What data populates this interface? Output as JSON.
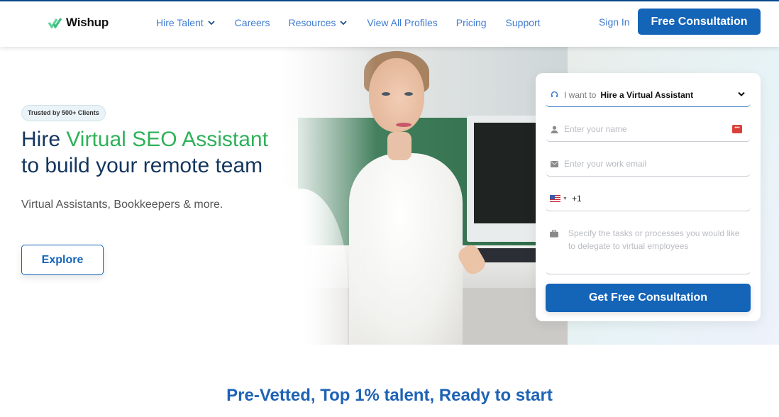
{
  "brand": {
    "name": "Wishup",
    "logo_icon": "double-check-icon",
    "accent_color": "#2fb15a",
    "primary_color": "#1464b8",
    "nav_link_color": "#3f7bd0",
    "heading_color": "#14365e"
  },
  "nav": {
    "links": [
      {
        "label": "Hire Talent",
        "has_dropdown": true
      },
      {
        "label": "Careers",
        "has_dropdown": false
      },
      {
        "label": "Resources",
        "has_dropdown": true
      },
      {
        "label": "View All Profiles",
        "has_dropdown": false
      },
      {
        "label": "Pricing",
        "has_dropdown": false
      },
      {
        "label": "Support",
        "has_dropdown": false
      }
    ],
    "sign_in": "Sign In",
    "cta": "Free Consultation"
  },
  "hero": {
    "badge": "Trusted by 500+ Clients",
    "headline_prefix": "Hire ",
    "headline_accent": "Virtual SEO Assistant",
    "headline_line2": "to build your remote team",
    "subtext": "Virtual Assistants, Bookkeepers & more.",
    "explore_button": "Explore",
    "image_alt": "Smiling woman in white blouse at office desk with computer"
  },
  "form": {
    "intent_label": "I want to",
    "intent_value": "Hire a Virtual Assistant",
    "name_placeholder": "Enter your name",
    "email_placeholder": "Enter your work email",
    "phone_country": "US",
    "phone_code": "+1",
    "tasks_placeholder": "Specify the tasks or processes you would like to delegate to virtual employees",
    "submit": "Get Free Consultation"
  },
  "section": {
    "title": "Pre-Vetted, Top 1% talent, Ready to start"
  }
}
